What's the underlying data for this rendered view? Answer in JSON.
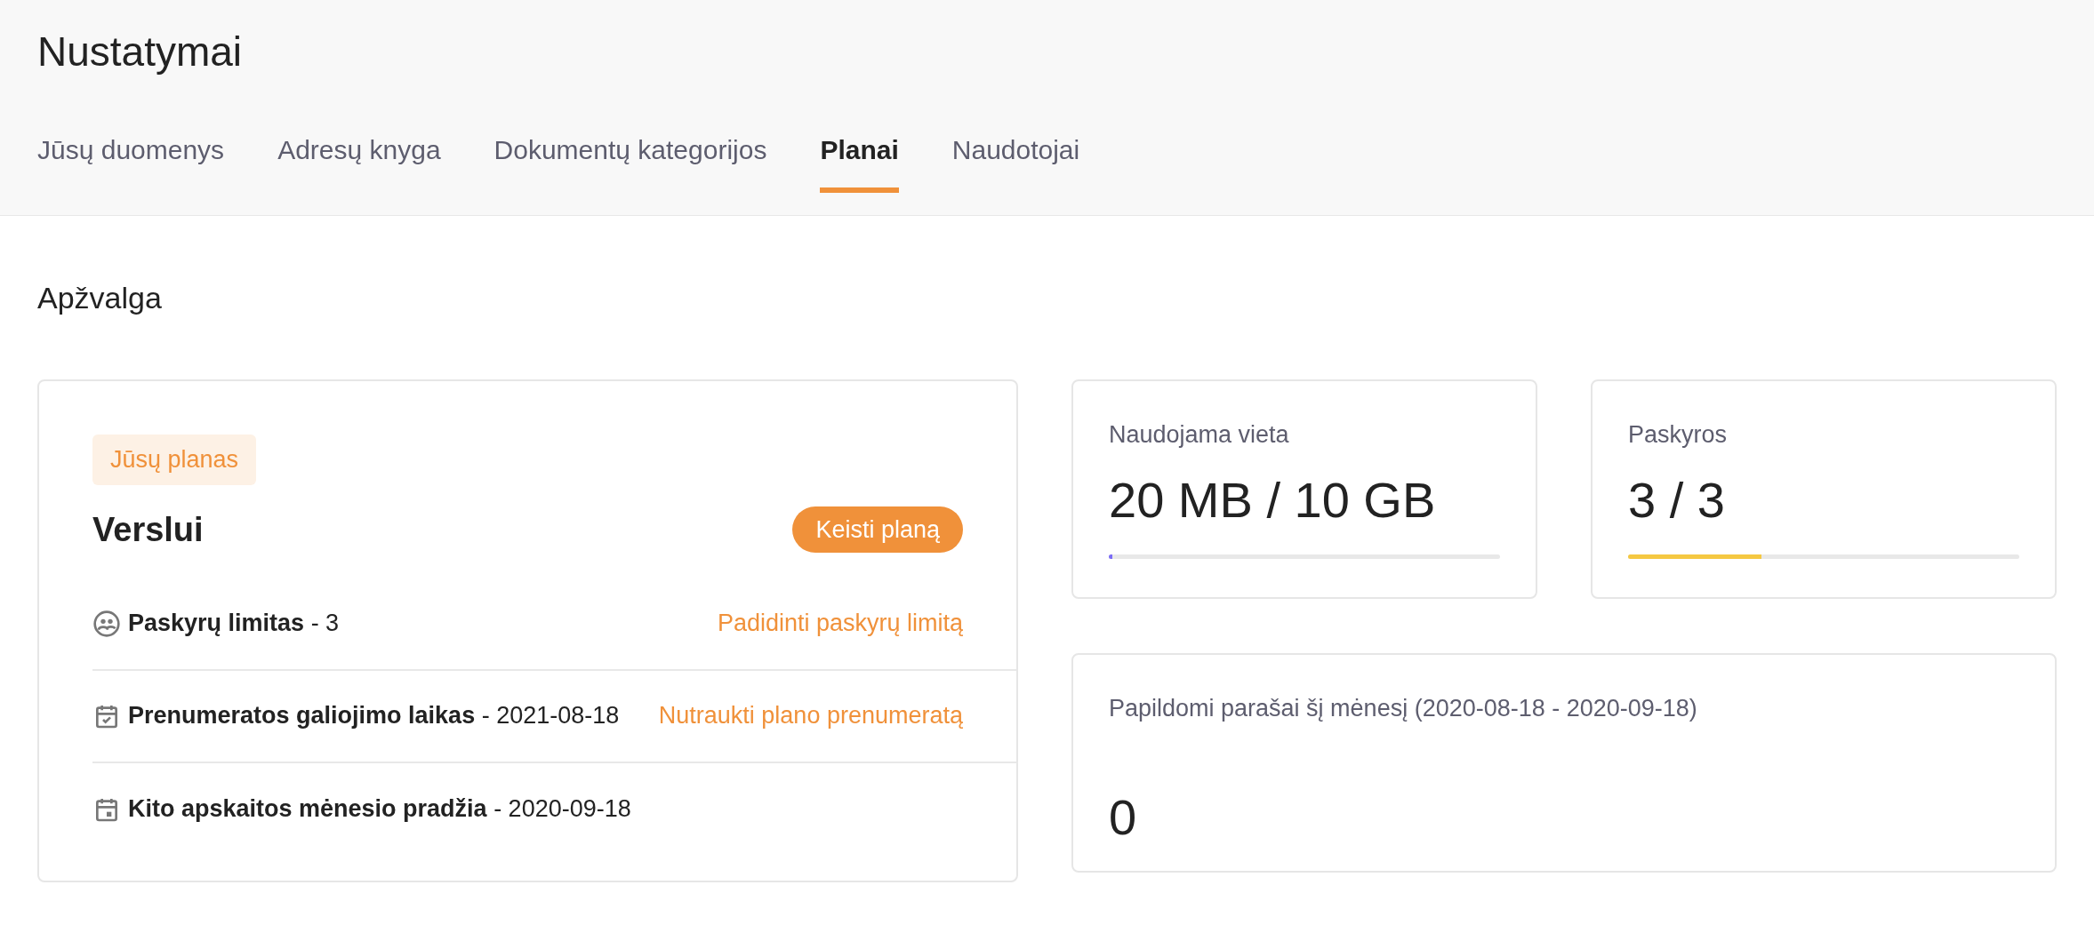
{
  "page": {
    "title": "Nustatymai"
  },
  "tabs": [
    {
      "label": "Jūsų duomenys",
      "selected": false
    },
    {
      "label": "Adresų knyga",
      "selected": false
    },
    {
      "label": "Dokumentų kategorijos",
      "selected": false
    },
    {
      "label": "Planai",
      "selected": true
    },
    {
      "label": "Naudotojai",
      "selected": false
    }
  ],
  "section_title": "Apžvalga",
  "plan_card": {
    "badge": "Jūsų planas",
    "plan_name": "Verslui",
    "change_button": "Keisti planą",
    "rows": [
      {
        "kind": "accounts",
        "label": "Paskyrų limitas",
        "value": " - 3",
        "action": "Padidinti paskyrų limitą"
      },
      {
        "kind": "calendar-check",
        "label": "Prenumeratos galiojimo laikas",
        "value": " - 2021-08-18",
        "action": "Nutraukti plano prenumeratą"
      },
      {
        "kind": "calendar",
        "label": "Kito apskaitos mėnesio pradžia",
        "value": " - 2020-09-18"
      }
    ]
  },
  "usage_cards": [
    {
      "label": "Naudojama vieta",
      "value": "20 MB / 10 GB",
      "level": 0.005,
      "color": "#7b6cf6"
    },
    {
      "label": "Paskyros",
      "value": "3 / 3",
      "level": 0.34,
      "color": "#f5c842"
    }
  ],
  "signatures_card": {
    "label": "Papildomi parašai šį mėnesį (2020-08-18 - 2020-09-18)",
    "value": "0"
  }
}
